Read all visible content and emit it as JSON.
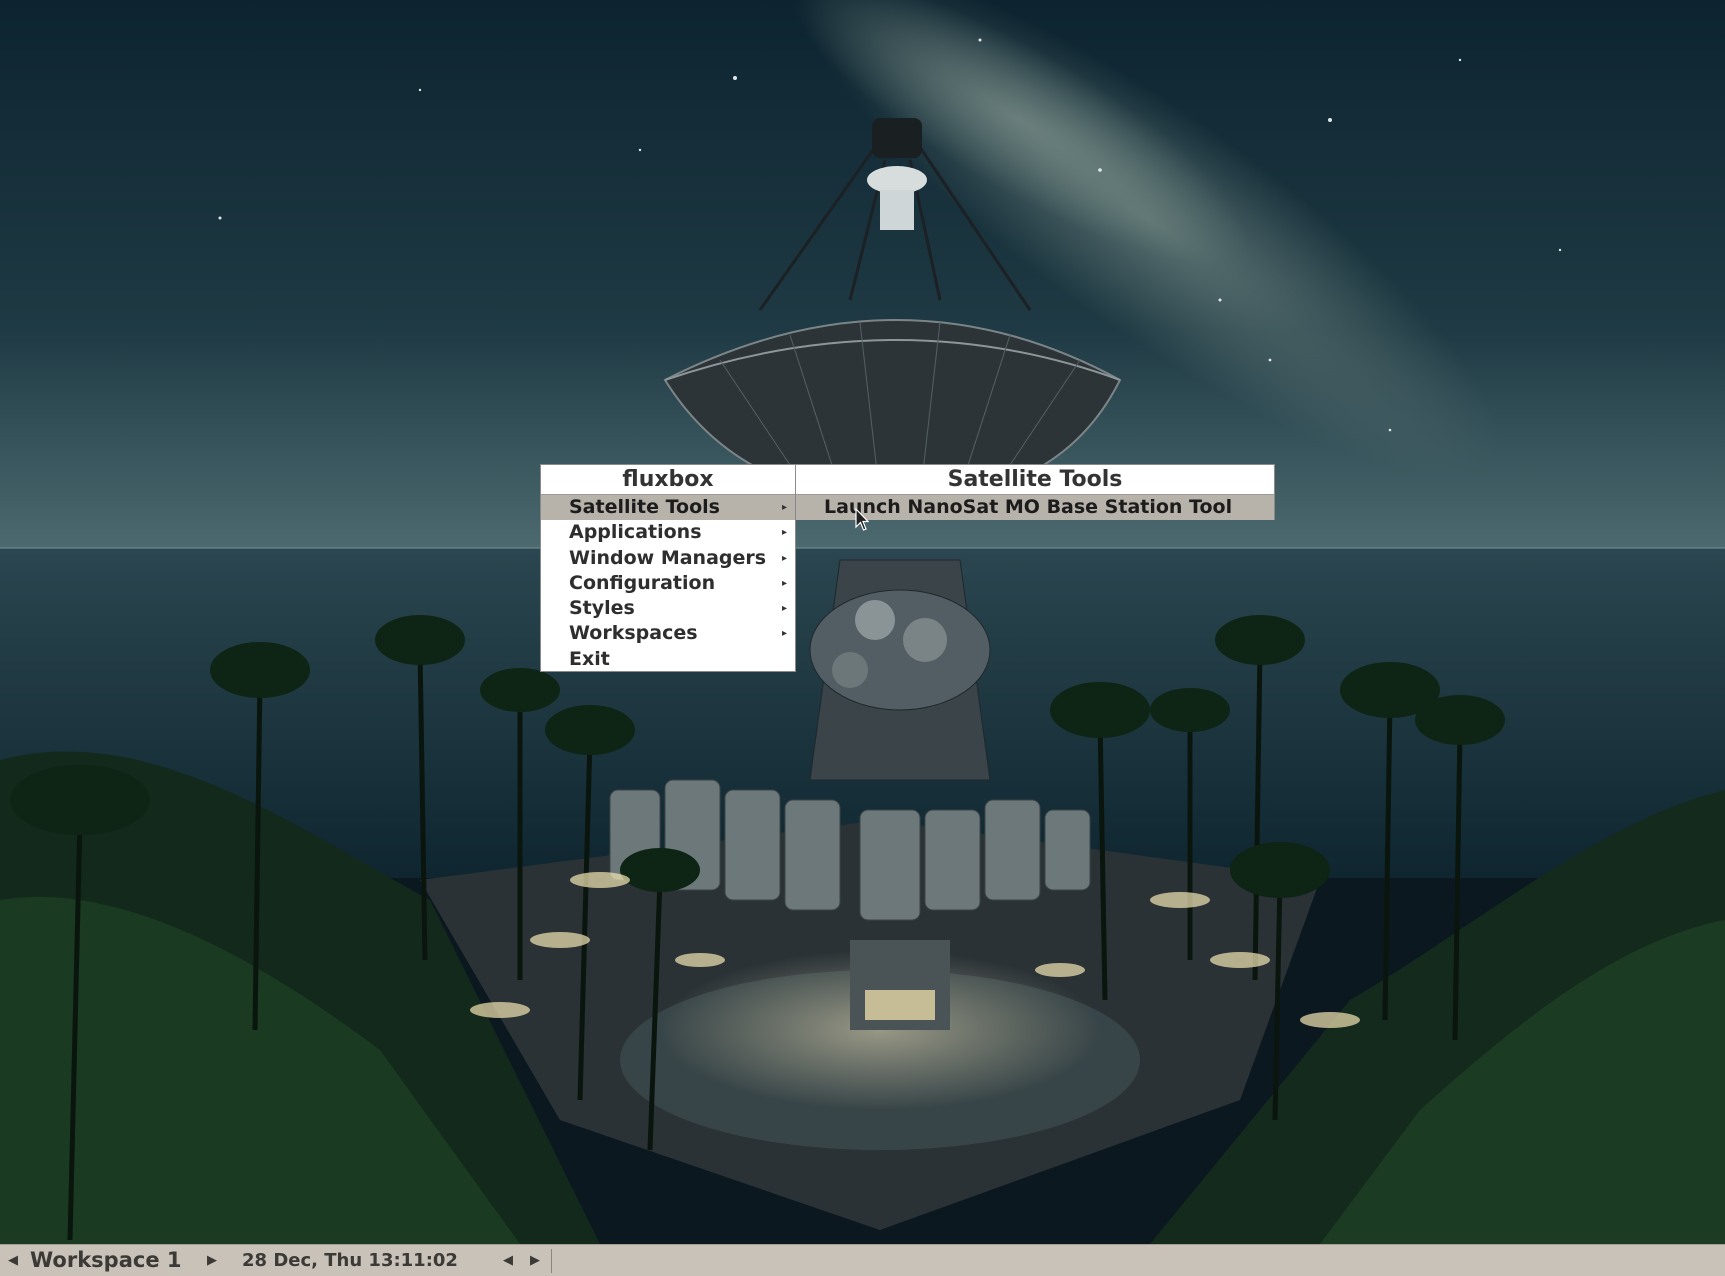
{
  "root_menu": {
    "title": "fluxbox",
    "items": [
      {
        "label": "Satellite Tools",
        "submenu": true,
        "selected": true
      },
      {
        "label": "Applications",
        "submenu": true
      },
      {
        "label": "Window Managers",
        "submenu": true
      },
      {
        "label": "Configuration",
        "submenu": true
      },
      {
        "label": "Styles",
        "submenu": true
      },
      {
        "label": "Workspaces",
        "submenu": true
      },
      {
        "label": "Exit",
        "submenu": false
      }
    ]
  },
  "sub_menu": {
    "title": "Satellite Tools",
    "items": [
      {
        "label": "Launch NanoSat MO Base Station Tool",
        "selected": true
      }
    ]
  },
  "toolbar": {
    "prev_workspace": "◀",
    "workspace_name": "Workspace 1",
    "next_workspace": "▶",
    "clock": "28 Dec, Thu 13:11:02",
    "prev_window": "◀",
    "next_window": "▶"
  },
  "icons": {
    "submenu_arrow": "▸",
    "pointer": "arrow-cursor-icon"
  },
  "colors": {
    "menu_bg": "#ffffff",
    "menu_selected": "#b7b2aa",
    "toolbar_bg": "#c8c2b8"
  }
}
